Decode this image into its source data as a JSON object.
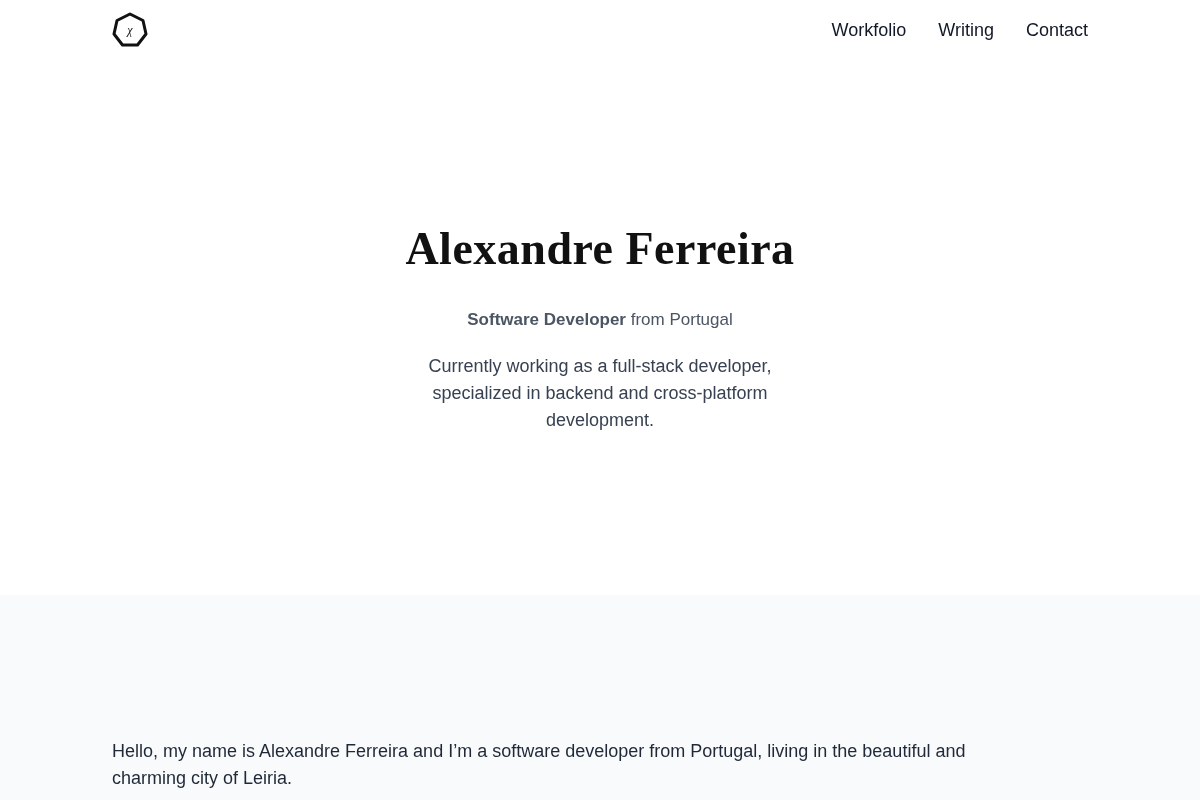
{
  "header": {
    "logo_mark": "χ",
    "nav": [
      "Workfolio",
      "Writing",
      "Contact"
    ]
  },
  "hero": {
    "name": "Alexandre Ferreira",
    "tagline": "**Software Developer** from Portugal",
    "summary": "Currently working as a full-stack developer, specialized in backend and cross-platform development."
  },
  "about": {
    "paragraphs": [
      "Hello, my name is Alexandre Ferreira and I’m a software developer from Portugal, living in the beautiful and charming city of Leiria."
    ]
  }
}
